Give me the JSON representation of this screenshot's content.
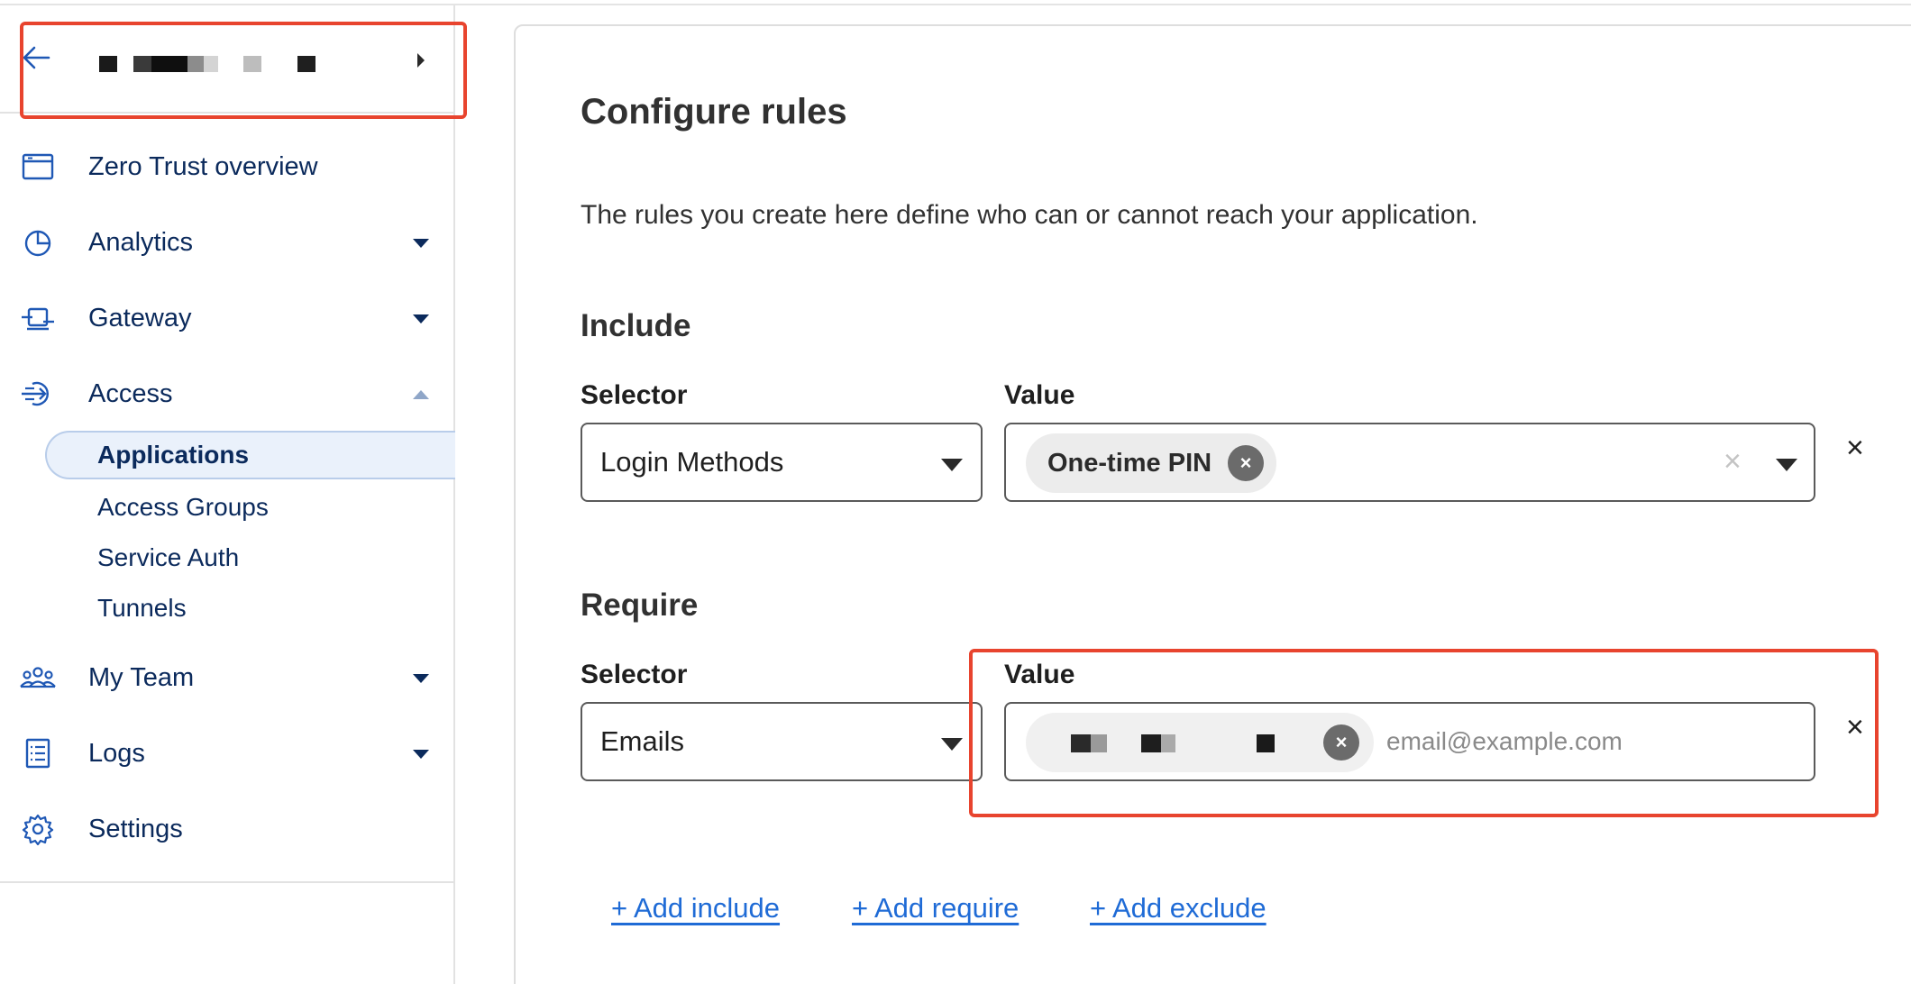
{
  "account": {
    "name": "■ ■■■■■ ■ ■ ■"
  },
  "sidebar": {
    "items": [
      {
        "label": "Zero Trust overview",
        "icon": "browser-window-icon"
      },
      {
        "label": "Analytics",
        "icon": "pie-chart-icon"
      },
      {
        "label": "Gateway",
        "icon": "gateway-icon"
      },
      {
        "label": "Access",
        "icon": "access-arrow-icon"
      },
      {
        "label": "My Team",
        "icon": "team-icon"
      },
      {
        "label": "Logs",
        "icon": "logs-icon"
      },
      {
        "label": "Settings",
        "icon": "gear-icon"
      }
    ],
    "access_subitems": [
      {
        "label": "Applications",
        "active": true
      },
      {
        "label": "Access Groups",
        "active": false
      },
      {
        "label": "Service Auth",
        "active": false
      },
      {
        "label": "Tunnels",
        "active": false
      }
    ]
  },
  "main": {
    "title": "Configure rules",
    "description": "The rules you create here define who can or cannot reach your application.",
    "include": {
      "heading": "Include",
      "selector_label": "Selector",
      "value_label": "Value",
      "selector_value": "Login Methods",
      "chip": "One-time PIN",
      "clear_symbol": "×",
      "remove_symbol": "×"
    },
    "require": {
      "heading": "Require",
      "selector_label": "Selector",
      "value_label": "Value",
      "selector_value": "Emails",
      "chip": "■■ ■■ ■",
      "placeholder": "email@example.com",
      "remove_symbol": "×"
    },
    "links": {
      "add_include": "+ Add include",
      "add_require": "+ Add require",
      "add_exclude": "+ Add exclude"
    }
  },
  "colors": {
    "nav_text": "#0b2a5c",
    "icon_blue": "#1f58b5",
    "link_blue": "#1f6bd6",
    "highlight_red": "#e8442e",
    "active_bg": "#eaf1fb"
  }
}
